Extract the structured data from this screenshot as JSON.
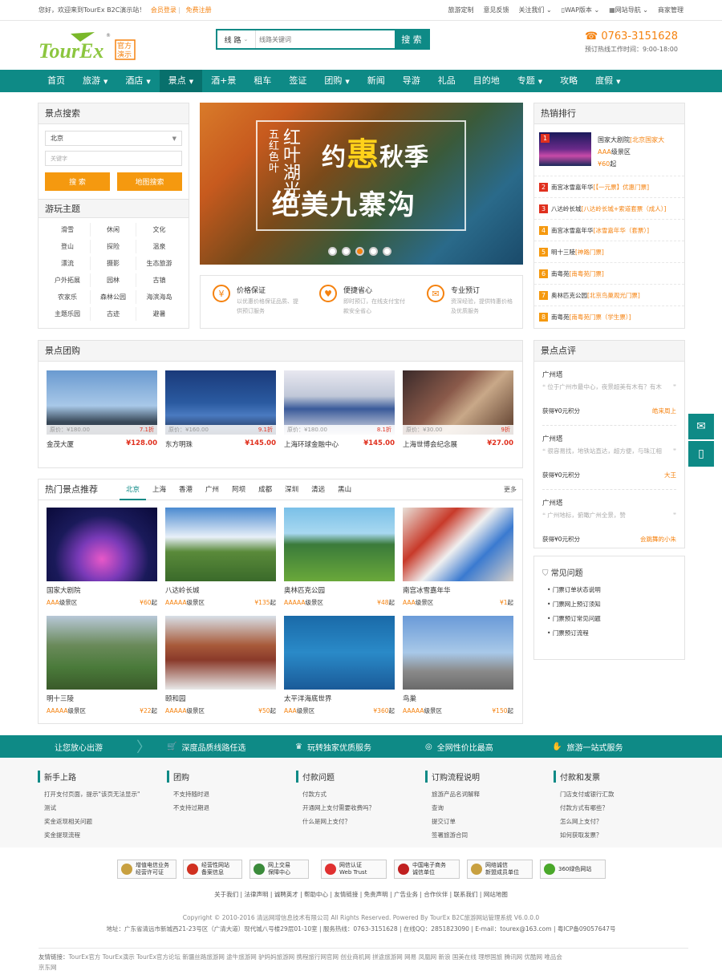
{
  "topbar": {
    "greeting": "您好，欢迎来到TourEx B2C演示站！",
    "login": "会员登录",
    "sep": "|",
    "register": "免费注册",
    "links": [
      "旅游定制",
      "意见反馈",
      "关注我们",
      "WAP版本",
      "网站导航",
      "商家管理"
    ]
  },
  "logo": {
    "text": "TourEx",
    "badge1": "官方",
    "badge2": "演示",
    "reg": "®"
  },
  "search": {
    "type": "线 路",
    "placeholder": "线路关键词",
    "button": "搜 索"
  },
  "hotline": {
    "number": "0763-3151628",
    "time": "预订热线工作时间：9:00-18:00"
  },
  "nav": {
    "items": [
      {
        "label": "首页",
        "caret": ""
      },
      {
        "label": "旅游",
        "caret": "▼"
      },
      {
        "label": "酒店",
        "caret": "▼"
      },
      {
        "label": "景点",
        "caret": "▼"
      },
      {
        "label": "酒+景",
        "caret": ""
      },
      {
        "label": "租车",
        "caret": ""
      },
      {
        "label": "签证",
        "caret": ""
      },
      {
        "label": "团购",
        "caret": "▼"
      },
      {
        "label": "新闻",
        "caret": ""
      },
      {
        "label": "导游",
        "caret": ""
      },
      {
        "label": "礼品",
        "caret": ""
      },
      {
        "label": "目的地",
        "caret": ""
      },
      {
        "label": "专题",
        "caret": "▼"
      },
      {
        "label": "攻略",
        "caret": ""
      },
      {
        "label": "度假",
        "caret": "▼"
      }
    ]
  },
  "spot_search": {
    "title": "景点搜索",
    "city": "北京",
    "keyword_placeholder": "关键字",
    "search_btn": "搜 索",
    "map_btn": "地图搜索",
    "theme_title": "游玩主题",
    "themes": [
      "滑雪",
      "休闲",
      "文化",
      "登山",
      "探险",
      "温泉",
      "漂流",
      "摄影",
      "生态旅游",
      "户外拓展",
      "园林",
      "古镇",
      "农家乐",
      "森林公园",
      "海滨海岛",
      "主题乐园",
      "古迹",
      "避暑"
    ]
  },
  "banner": {
    "small1": "五红",
    "small1b": "色叶",
    "small2": "红叶",
    "small2b": "湖光",
    "big_pre": "约",
    "big_hui": "惠",
    "big_post": "秋季",
    "title": "绝美九寨沟"
  },
  "features": [
    {
      "icon": "¥",
      "title": "价格保证",
      "desc": "以优惠价格保证品质、提供预订服务"
    },
    {
      "icon": "♥",
      "title": "便捷省心",
      "desc": "即时预订，在线支付宝付款安全省心"
    },
    {
      "icon": "✉",
      "title": "专业预订",
      "desc": "资深经验，提供特惠价格及优质服务"
    }
  ],
  "hot_rank": {
    "title": "热销排行",
    "first": {
      "no": "1",
      "name": "国家大剧院",
      "tag": "[北京国家大",
      "level": "AAA级景区",
      "price": "¥60",
      "price_unit": "起"
    },
    "items": [
      {
        "no": "2",
        "name": "南宫冰雪嘉年华",
        "tag": "[【一元票】优惠门票]"
      },
      {
        "no": "3",
        "name": "八达岭长城",
        "tag": "[八达岭长城+索道套票（成人）]"
      },
      {
        "no": "4",
        "name": "南宫冰雪嘉年华",
        "tag": "[冰雪嘉年华（套票）]"
      },
      {
        "no": "5",
        "name": "明十三陵",
        "tag": "[神路门票]"
      },
      {
        "no": "6",
        "name": "南粤苑",
        "tag": "[南粤苑门票]"
      },
      {
        "no": "7",
        "name": "奥林匹克公园",
        "tag": "[北京鸟巢观光门票]"
      },
      {
        "no": "8",
        "name": "南粤苑",
        "tag": "[南粤苑门票（学生票）]"
      }
    ]
  },
  "tuan": {
    "title": "景点团购",
    "items": [
      {
        "orig": "原价：¥180.00",
        "disc": "7.1折",
        "name": "金茂大厦",
        "price": "¥128.00"
      },
      {
        "orig": "原价：¥160.00",
        "disc": "9.1折",
        "name": "东方明珠",
        "price": "¥145.00"
      },
      {
        "orig": "原价：¥180.00",
        "disc": "8.1折",
        "name": "上海环球金融中心",
        "price": "¥145.00"
      },
      {
        "orig": "原价：¥30.00",
        "disc": "9折",
        "name": "上海世博会纪念展",
        "price": "¥27.00"
      }
    ]
  },
  "hot_rec": {
    "title": "热门景点推荐",
    "tabs": [
      "北京",
      "上海",
      "香港",
      "广州",
      "阿坝",
      "成都",
      "深圳",
      "清远",
      "黑山"
    ],
    "more": "更多",
    "items": [
      {
        "name": "国家大剧院",
        "level": "AAA",
        "level_suffix": "级景区",
        "price": "¥60",
        "unit": "起"
      },
      {
        "name": "八达岭长城",
        "level": "AAAAA",
        "level_suffix": "级景区",
        "price": "¥135",
        "unit": "起"
      },
      {
        "name": "奥林匹克公园",
        "level": "AAAAA",
        "level_suffix": "级景区",
        "price": "¥48",
        "unit": "起"
      },
      {
        "name": "南宫冰雪嘉年华",
        "level": "AAA",
        "level_suffix": "级景区",
        "price": "¥1",
        "unit": "起"
      },
      {
        "name": "明十三陵",
        "level": "AAAAA",
        "level_suffix": "级景区",
        "price": "¥22",
        "unit": "起"
      },
      {
        "name": "颐和园",
        "level": "AAAAA",
        "level_suffix": "级景区",
        "price": "¥50",
        "unit": "起"
      },
      {
        "name": "太平洋海底世界",
        "level": "AAA",
        "level_suffix": "级景区",
        "price": "¥360",
        "unit": "起"
      },
      {
        "name": "鸟巢",
        "level": "AAAAA",
        "level_suffix": "级景区",
        "price": "¥150",
        "unit": "起"
      }
    ]
  },
  "reviews": {
    "title": "景点点评",
    "items": [
      {
        "name": "广州塔",
        "content": "位于广州市最中心，夜景超美有木有？有木",
        "points": "获得¥0元积分",
        "user": "皓来周上"
      },
      {
        "name": "广州塔",
        "content": "很容易找，地铁站直达，超方便，与珠江相",
        "points": "获得¥0元积分",
        "user": "大王"
      },
      {
        "name": "广州塔",
        "content": "广州地标，俯瞰广州全景，赞",
        "points": "获得¥0元积分",
        "user": "会跳舞的小朱"
      }
    ]
  },
  "faq": {
    "title": "常见问题",
    "items": [
      "门票订单状态说明",
      "门票网上预订须知",
      "门票预订常见问题",
      "门票预订流程"
    ]
  },
  "service_bar": {
    "items": [
      "让您放心出游",
      "深度品质线路任选",
      "玩转独家优质服务",
      "全网性价比最高",
      "旅游一站式服务"
    ]
  },
  "footer_cols": [
    {
      "title": "新手上路",
      "links": [
        "打开支付页面，提示\"该页无法显示\"",
        "测试",
        "奖金返现相关问题",
        "奖金提现流程"
      ]
    },
    {
      "title": "团购",
      "links": [
        "不支持随时退",
        "不支持过期退"
      ]
    },
    {
      "title": "付款问题",
      "links": [
        "付款方式",
        "开通网上支付需要收费吗？",
        "什么是网上支付？"
      ]
    },
    {
      "title": "订购流程说明",
      "links": [
        "旅游产品名词解释",
        "查询",
        "提交订单",
        "签署旅游合同"
      ]
    },
    {
      "title": "付款和发票",
      "links": [
        "门店支付或银行汇款",
        "付款方式有哪些？",
        "怎么网上支付？",
        "如何获取发票？"
      ]
    }
  ],
  "certs": [
    {
      "l1": "增值电信业务",
      "l2": "经营许可证",
      "color": "#c8a040"
    },
    {
      "l1": "经营性网站",
      "l2": "备案信息",
      "color": "#d03020"
    },
    {
      "l1": "网上交易",
      "l2": "保障中心",
      "color": "#3a8a3a"
    },
    {
      "l1": "网信认证",
      "l2": "Web Trust",
      "color": "#e03030"
    },
    {
      "l1": "中国电子商务",
      "l2": "诚信单位",
      "color": "#c02020"
    },
    {
      "l1": "网络诚信",
      "l2": "新盟成员单位",
      "color": "#c8a040"
    },
    {
      "l1": "360绿色网站",
      "l2": "",
      "color": "#4aa82a"
    }
  ],
  "footer_links": "关于我们 | 法律声明 | 诚聘英才 | 帮助中心 | 友情链接 | 免责声明 | 广告业务 | 合作伙伴 | 联系我们 | 网站地图",
  "copyright": "Copyright © 2010-2016 清远网增信息技术有限公司 All Rights Reserved. Powered By TourEx B2C旅游网站管理系统 V6.0.0.0",
  "address": "地址：广东省清远市新城西21-23号区（广清大道）现代城八号楼29层01-10室 | 服务热线：0763-3151628 | 在线QQ：2851823090 | E-mail：tourex@163.com | 粤ICP备09057647号",
  "friends": {
    "label": "友情链接：",
    "links": "TourEx官方   TourEx演示   TourEx官方论坛   新疆丝路旅游网   途牛旅游网   驴妈妈旅游网   携程旅行网官网   创业商机网   拼途旅游网   网易   凤凰网   新浪   国美在线   理想国旅   腾讯网   优酷网   唯品会",
    "tail": "京东网"
  }
}
